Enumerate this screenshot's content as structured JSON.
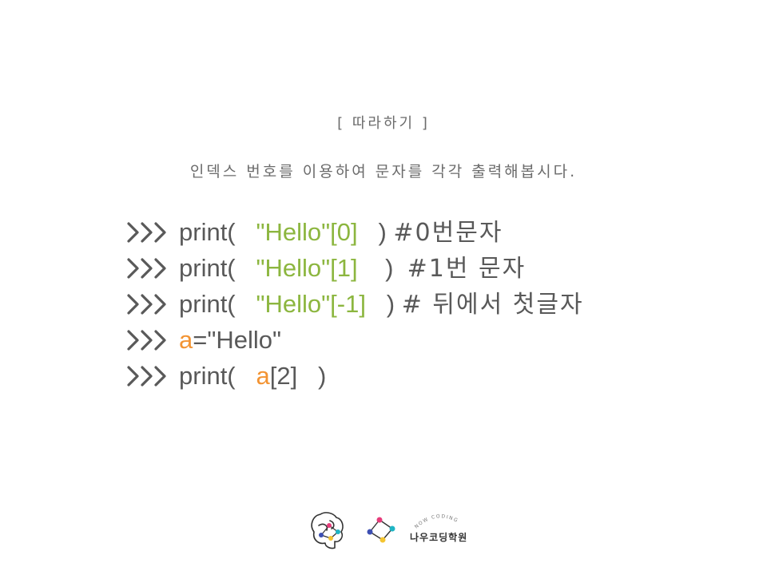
{
  "slide": {
    "title": "[ 따라하기 ]",
    "subtitle": "인덱스 번호를 이용하여 문자를 각각 출력해봅시다.",
    "colors": {
      "text": "#595959",
      "string": "#8cb63f",
      "variable": "#f39433",
      "heading": "#6b6b6b"
    },
    "prompt_icon": "triple-chevron-right-icon",
    "code_lines": [
      {
        "fn": "print(",
        "str": "\"Hello\"[0]",
        "close": ")",
        "comment": "#0번문자"
      },
      {
        "fn": "print(",
        "str": "\"Hello\"[1]",
        "close": ")",
        "comment": "#1번 문자"
      },
      {
        "fn": "print(",
        "str": "\"Hello\"[-1]",
        "close": ")",
        "comment": "# 뒤에서 첫글자"
      },
      {
        "var": "a",
        "rest": "=\"Hello\""
      },
      {
        "fn": "print(",
        "var": "a",
        "index": "[2]",
        "close": ")"
      }
    ]
  },
  "logo": {
    "arc_text": "NOW CODING",
    "name": "나우코딩학원",
    "icons": [
      "brain-icon",
      "network-diamond-icon"
    ],
    "dot_colors": [
      "#e63b7a",
      "#1fb5c4",
      "#f4c531",
      "#3d4fb3",
      "#8cc63f"
    ]
  }
}
